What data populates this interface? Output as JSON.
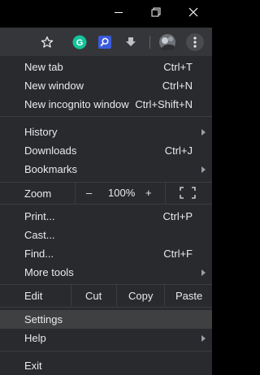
{
  "window_controls": {
    "minimize_icon": "minimize-icon",
    "restore_icon": "restore-icon",
    "close_icon": "close-icon"
  },
  "toolbar": {
    "icons": [
      "star-icon",
      "grammarly-icon",
      "search-extension-icon",
      "download-extension-icon",
      "profile-avatar",
      "menu-dots-icon"
    ]
  },
  "menu": {
    "new_tab": {
      "label": "New tab",
      "shortcut": "Ctrl+T"
    },
    "new_window": {
      "label": "New window",
      "shortcut": "Ctrl+N"
    },
    "new_incognito": {
      "label": "New incognito window",
      "shortcut": "Ctrl+Shift+N"
    },
    "history": {
      "label": "History"
    },
    "downloads": {
      "label": "Downloads",
      "shortcut": "Ctrl+J"
    },
    "bookmarks": {
      "label": "Bookmarks"
    },
    "zoom": {
      "label": "Zoom",
      "minus": "–",
      "value": "100%",
      "plus": "+"
    },
    "print": {
      "label": "Print...",
      "shortcut": "Ctrl+P"
    },
    "cast": {
      "label": "Cast..."
    },
    "find": {
      "label": "Find...",
      "shortcut": "Ctrl+F"
    },
    "more_tools": {
      "label": "More tools"
    },
    "edit": {
      "label": "Edit",
      "cut": "Cut",
      "copy": "Copy",
      "paste": "Paste"
    },
    "settings": {
      "label": "Settings"
    },
    "help": {
      "label": "Help"
    },
    "exit": {
      "label": "Exit"
    }
  },
  "colors": {
    "menu_bg": "#292a2d",
    "toolbar_bg": "#35363a",
    "highlight": "#3f4042",
    "text": "#e8eaed",
    "grammarly_green": "#15c39a",
    "extension_blue": "#3b5bdb"
  }
}
